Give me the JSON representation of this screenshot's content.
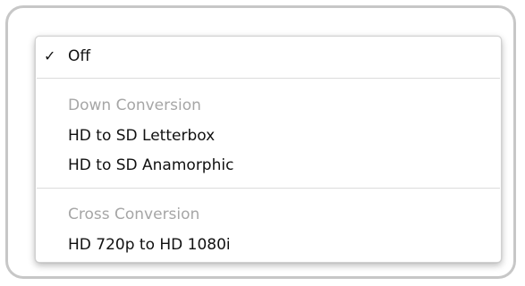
{
  "menu": {
    "off": {
      "check_glyph": "✓",
      "label": "Off",
      "checked": true
    },
    "down_conversion": {
      "header": "Down Conversion",
      "items": [
        {
          "label": "HD to SD Letterbox"
        },
        {
          "label": "HD to SD Anamorphic"
        }
      ]
    },
    "cross_conversion": {
      "header": "Cross Conversion",
      "items": [
        {
          "label": "HD 720p to HD 1080i"
        }
      ]
    }
  },
  "colors": {
    "enabled_text": "#111111",
    "header_text": "#a6a6a6",
    "separator": "#dcdcdc",
    "frame_border": "#c7c7c7"
  }
}
